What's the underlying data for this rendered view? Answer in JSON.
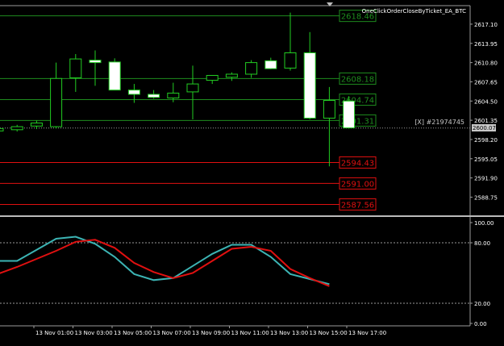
{
  "indicator_title": "OneClickOrderCloseByTicket_EA_BTC",
  "order_label": "[X] #21974745",
  "current_price_label": "2600.07",
  "price_axis_ticks": [
    "2617.10",
    "2613.95",
    "2610.80",
    "2607.65",
    "2604.50",
    "2601.35",
    "2598.20",
    "2595.05",
    "2591.90",
    "2588.75"
  ],
  "osc_axis_ticks": [
    "100.00",
    "80.00",
    "20.00",
    "0.00"
  ],
  "time_labels": [
    "13 Nov 01:00",
    "13 Nov 03:00",
    "13 Nov 05:00",
    "13 Nov 07:00",
    "13 Nov 09:00",
    "13 Nov 11:00",
    "13 Nov 13:00",
    "13 Nov 15:00",
    "13 Nov 17:00"
  ],
  "levels": [
    {
      "label": "2618.46",
      "price": 2618.46,
      "color": "#1e8c1e"
    },
    {
      "label": "2608.18",
      "price": 2608.18,
      "color": "#1e8c1e"
    },
    {
      "label": "2604.74",
      "price": 2604.74,
      "color": "#1e8c1e"
    },
    {
      "label": "2601.31",
      "price": 2601.31,
      "color": "#1e8c1e"
    },
    {
      "label": "2594.43",
      "price": 2594.43,
      "color": "#e01010"
    },
    {
      "label": "2591.00",
      "price": 2591.0,
      "color": "#e01010"
    },
    {
      "label": "2587.56",
      "price": 2587.56,
      "color": "#e01010"
    }
  ],
  "chart_data": {
    "type": "candlestick",
    "price_range": [
      2585.9,
      2620.0
    ],
    "candles": [
      {
        "o": 2599.6,
        "h": 2600.0,
        "l": 2599.0,
        "c": 2600.0
      },
      {
        "o": 2599.8,
        "h": 2600.6,
        "l": 2599.5,
        "c": 2600.3
      },
      {
        "o": 2600.4,
        "h": 2601.3,
        "l": 2599.9,
        "c": 2600.9
      },
      {
        "o": 2600.3,
        "h": 2610.8,
        "l": 2600.0,
        "c": 2608.2
      },
      {
        "o": 2608.3,
        "h": 2612.2,
        "l": 2606.0,
        "c": 2611.4
      },
      {
        "o": 2611.2,
        "h": 2612.8,
        "l": 2607.0,
        "c": 2610.8
      },
      {
        "o": 2610.9,
        "h": 2611.5,
        "l": 2606.3,
        "c": 2606.3
      },
      {
        "o": 2606.3,
        "h": 2607.3,
        "l": 2604.2,
        "c": 2605.6
      },
      {
        "o": 2605.6,
        "h": 2606.3,
        "l": 2604.9,
        "c": 2605.1
      },
      {
        "o": 2605.0,
        "h": 2607.5,
        "l": 2604.3,
        "c": 2605.8
      },
      {
        "o": 2606.0,
        "h": 2610.3,
        "l": 2601.5,
        "c": 2607.3
      },
      {
        "o": 2607.9,
        "h": 2608.7,
        "l": 2607.3,
        "c": 2608.7
      },
      {
        "o": 2608.4,
        "h": 2609.2,
        "l": 2607.8,
        "c": 2608.9
      },
      {
        "o": 2608.9,
        "h": 2611.2,
        "l": 2608.3,
        "c": 2610.8
      },
      {
        "o": 2611.1,
        "h": 2611.6,
        "l": 2609.7,
        "c": 2609.8
      },
      {
        "o": 2609.9,
        "h": 2619.0,
        "l": 2609.5,
        "c": 2612.4
      },
      {
        "o": 2612.4,
        "h": 2615.8,
        "l": 2601.5,
        "c": 2601.7
      },
      {
        "o": 2601.7,
        "h": 2606.8,
        "l": 2593.8,
        "c": 2604.6
      },
      {
        "o": 2604.5,
        "h": 2605.3,
        "l": 2600.0,
        "c": 2600.1
      }
    ],
    "oscillator": {
      "range": [
        0,
        100
      ],
      "levels": [
        80,
        20
      ],
      "main": [
        62,
        62,
        73,
        84,
        86,
        79,
        66,
        49,
        43,
        45,
        57,
        69,
        78,
        78,
        66,
        49,
        44,
        39
      ],
      "signal": [
        49,
        56,
        64,
        72,
        81,
        83,
        75,
        60,
        51,
        45,
        50,
        62,
        74,
        76,
        72,
        54,
        45,
        37
      ]
    }
  }
}
